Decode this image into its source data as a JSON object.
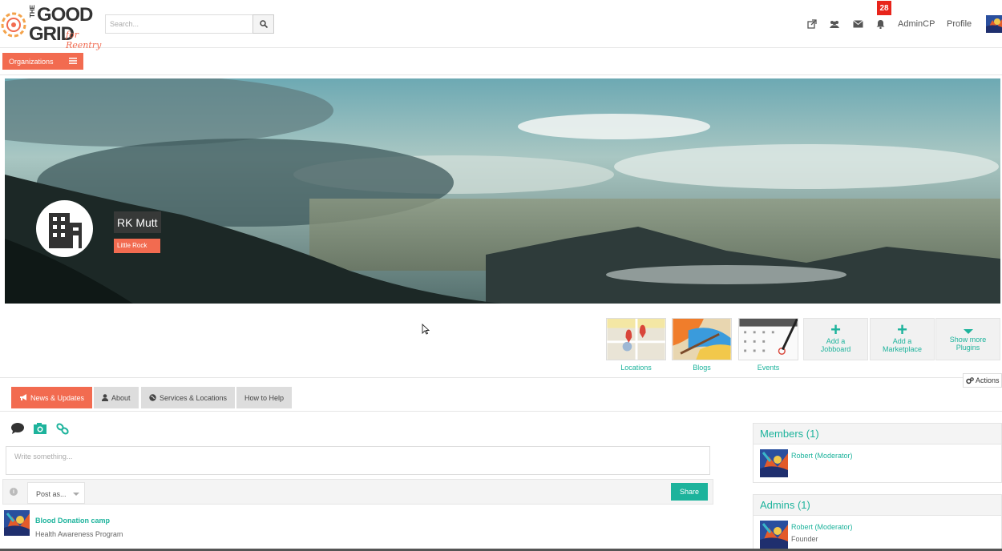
{
  "brand": {
    "line_the": "THE",
    "line_good": "GOOD",
    "line_grid": "GRID",
    "tagline": "for Reentry",
    "accent_color": "#f26b50",
    "teal_color": "#1db39c"
  },
  "header": {
    "search_placeholder": "Search...",
    "notification_count": "28",
    "links": [
      "AdminCP",
      "Profile"
    ],
    "icons": [
      "external-link-icon",
      "users-icon",
      "envelope-icon",
      "bell-icon"
    ]
  },
  "org_menu": {
    "label": "Organizations"
  },
  "cover": {
    "name": "RK Mutt",
    "location": "Little Rock"
  },
  "plugins": [
    {
      "label": "Locations"
    },
    {
      "label": "Blogs"
    },
    {
      "label": "Events"
    }
  ],
  "plugin_actions": [
    {
      "line1": "Add a",
      "line2": "Jobboard"
    },
    {
      "line1": "Add a",
      "line2": "Marketplace"
    },
    {
      "line1": "Show more",
      "line2": "Plugins"
    }
  ],
  "actions_label": "Actions",
  "tabs": [
    {
      "label": "News & Updates",
      "active": true
    },
    {
      "label": "About",
      "active": false
    },
    {
      "label": "Services & Locations",
      "active": false
    },
    {
      "label": "How to Help",
      "active": false
    }
  ],
  "composer": {
    "placeholder": "Write something...",
    "post_as": "Post as...",
    "share": "Share",
    "info": "i"
  },
  "feed": [
    {
      "title": "Blood Donation camp",
      "subtitle": "Health Awareness Program"
    }
  ],
  "members_panel": {
    "title": "Members (1)",
    "items": [
      {
        "name": "Robert (Moderator)"
      }
    ]
  },
  "admins_panel": {
    "title": "Admins (1)",
    "items": [
      {
        "name": "Robert (Moderator)",
        "role": "Founder"
      }
    ]
  }
}
